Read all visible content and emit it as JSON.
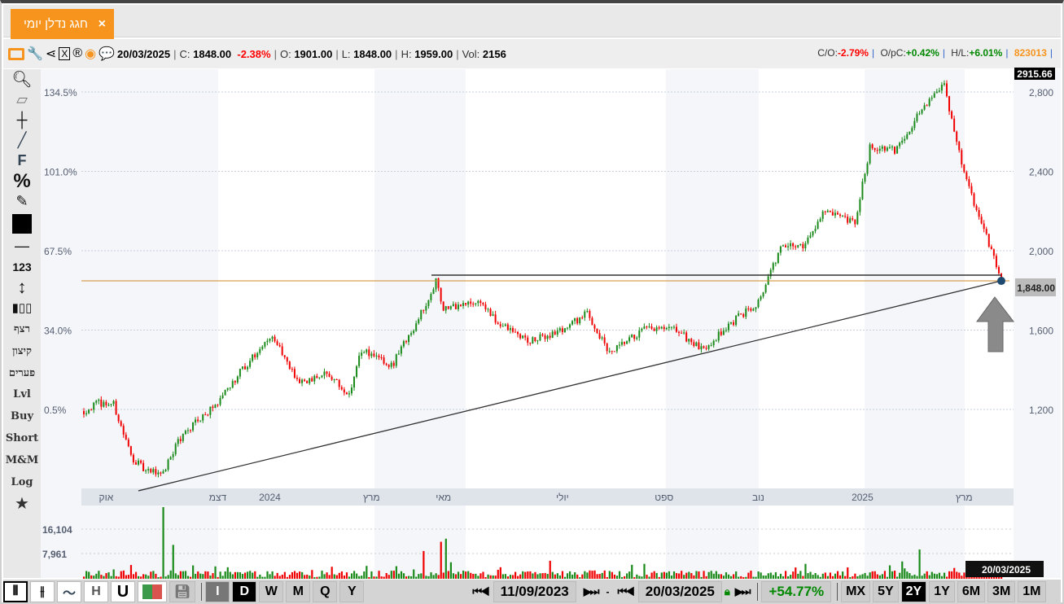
{
  "tab": {
    "title": "חגג נדלן יומי",
    "close": "×"
  },
  "info": {
    "date": "20/03/2025",
    "c_label": "C:",
    "close": "1848.00",
    "change": "-2.38%",
    "o_label": "O:",
    "open": "1901.00",
    "l_label": "L:",
    "low": "1848.00",
    "h_label": "H:",
    "high": "1959.00",
    "vol_label": "Vol:",
    "vol": "2156",
    "co_label": "C/O:",
    "co": "-2.79%",
    "opc_label": "O/pC:",
    "opc": "+0.42%",
    "hl_label": "H/L:",
    "hl": "+6.01%",
    "code": "823013"
  },
  "tools": {
    "labels": [
      "רצף",
      "קיצון",
      "פערים",
      "Lvl",
      "Buy",
      "Short",
      "M&M",
      "Log"
    ],
    "text_123": "123",
    "text_f": "F",
    "text_pct": "%"
  },
  "bottom": {
    "chart_types": [
      "candles",
      "ohlc",
      "line",
      "H",
      "U",
      "color"
    ],
    "intervals": [
      "I",
      "D",
      "W",
      "M",
      "Q",
      "Y"
    ],
    "from_date": "11/09/2023",
    "to_date": "20/03/2025",
    "dash": "-",
    "period_change": "+54.77%",
    "ranges": [
      "MX",
      "5Y",
      "2Y",
      "1Y",
      "6M",
      "3M",
      "1M"
    ],
    "selected_range": "2Y",
    "selected_interval": "D"
  },
  "chart_data": {
    "type": "candlestick",
    "price_max_label": "2915.66",
    "last_price_label": "1,848.00",
    "last_date_label": "20/03/2025",
    "y_right_ticks": [
      {
        "v": 1200,
        "label": "1,200"
      },
      {
        "v": 1600,
        "label": "1,600"
      },
      {
        "v": 2000,
        "label": "2,000"
      },
      {
        "v": 2400,
        "label": "2,400"
      },
      {
        "v": 2800,
        "label": "2,800"
      }
    ],
    "y_left_ticks": [
      {
        "v": 1200,
        "label": "0.5%"
      },
      {
        "v": 1600,
        "label": "34.0%"
      },
      {
        "v": 2000,
        "label": "67.5%"
      },
      {
        "v": 2400,
        "label": "101.0%"
      },
      {
        "v": 2800,
        "label": "134.5%"
      }
    ],
    "x_ticks": [
      {
        "d": 9,
        "label": "אוק"
      },
      {
        "d": 54,
        "label": "דצמ"
      },
      {
        "d": 75,
        "label": "2024"
      },
      {
        "d": 116,
        "label": "מרץ"
      },
      {
        "d": 145,
        "label": "מאי"
      },
      {
        "d": 193,
        "label": "יולי"
      },
      {
        "d": 234,
        "label": "ספט"
      },
      {
        "d": 272,
        "label": "נוב"
      },
      {
        "d": 314,
        "label": "2025"
      },
      {
        "d": 355,
        "label": "מרץ"
      }
    ],
    "volume_ticks": [
      {
        "v": 16104,
        "label": "16,104"
      },
      {
        "v": 7961,
        "label": "7,961"
      }
    ],
    "close_path": [
      [
        0,
        1192
      ],
      [
        6,
        1233
      ],
      [
        12,
        1225
      ],
      [
        19,
        966
      ],
      [
        25,
        884
      ],
      [
        32,
        884
      ],
      [
        38,
        1048
      ],
      [
        52,
        1212
      ],
      [
        65,
        1417
      ],
      [
        76,
        1582
      ],
      [
        86,
        1335
      ],
      [
        98,
        1376
      ],
      [
        107,
        1274
      ],
      [
        112,
        1499
      ],
      [
        124,
        1417
      ],
      [
        137,
        1705
      ],
      [
        142,
        1848
      ],
      [
        145,
        1705
      ],
      [
        160,
        1745
      ],
      [
        166,
        1643
      ],
      [
        180,
        1540
      ],
      [
        193,
        1602
      ],
      [
        203,
        1684
      ],
      [
        212,
        1479
      ],
      [
        226,
        1602
      ],
      [
        239,
        1602
      ],
      [
        249,
        1499
      ],
      [
        262,
        1643
      ],
      [
        272,
        1745
      ],
      [
        281,
        2012
      ],
      [
        291,
        2033
      ],
      [
        298,
        2197
      ],
      [
        311,
        2135
      ],
      [
        317,
        2525
      ],
      [
        327,
        2504
      ],
      [
        340,
        2750
      ],
      [
        347,
        2833
      ],
      [
        354,
        2443
      ],
      [
        360,
        2197
      ],
      [
        365,
        2033
      ],
      [
        370,
        1848
      ]
    ],
    "volume_spikes": [
      [
        32,
        26000
      ],
      [
        36,
        11000
      ],
      [
        137,
        9000
      ],
      [
        144,
        12000
      ],
      [
        146,
        13000
      ],
      [
        337,
        9500
      ]
    ],
    "resistance_level": 1877,
    "current_level": 1848,
    "trendline": [
      [
        22,
        790
      ],
      [
        370,
        1848
      ]
    ],
    "colors": {
      "up": "#1a8a1a",
      "down": "#f00000",
      "accent": "#f7941d"
    }
  }
}
